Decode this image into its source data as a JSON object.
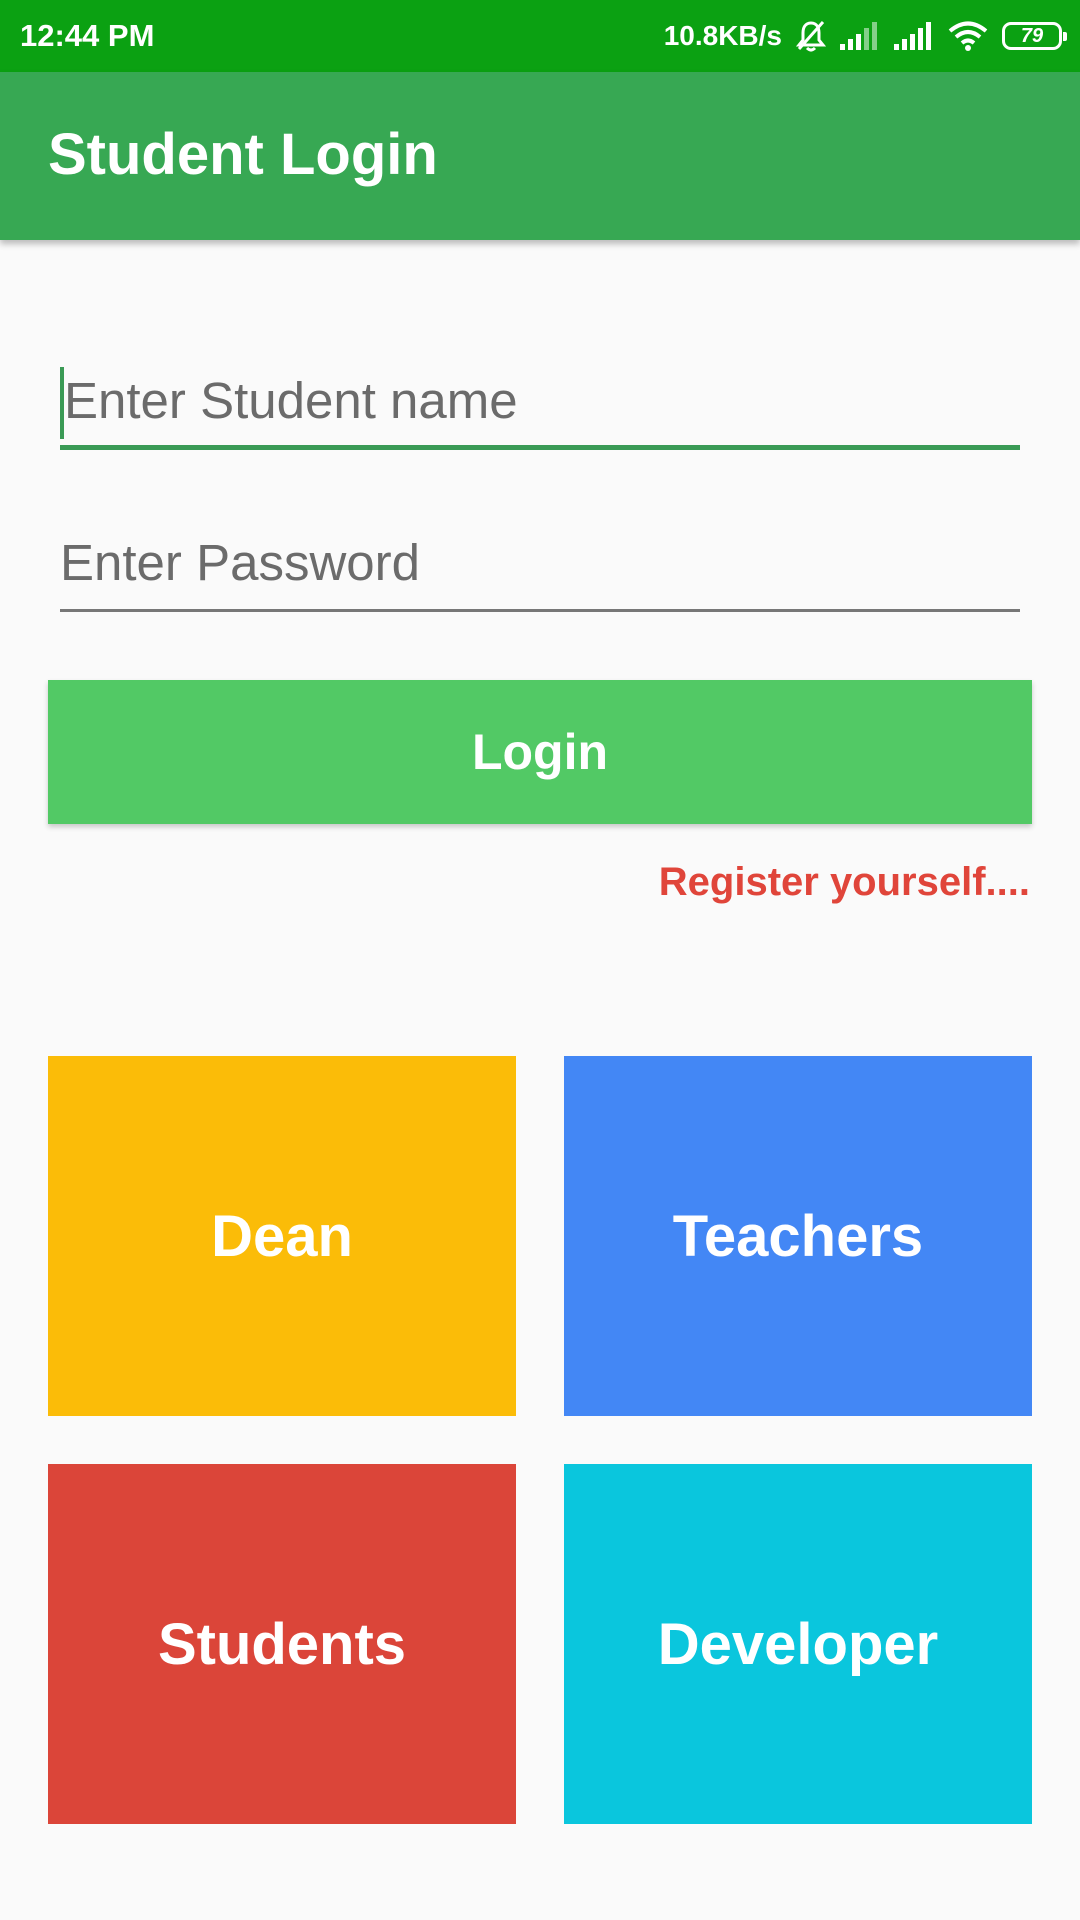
{
  "status_bar": {
    "time": "12:44 PM",
    "network_speed": "10.8KB/s",
    "battery_level": "79",
    "icons": [
      "mute-bell-icon",
      "signal-icon",
      "signal-icon",
      "wifi-icon",
      "battery-icon"
    ]
  },
  "app_bar": {
    "title": "Student Login",
    "color": "#37a853"
  },
  "form": {
    "name_placeholder": "Enter Student name",
    "password_placeholder": "Enter Password",
    "login_label": "Login",
    "register_label": "Register yourself...."
  },
  "tiles": [
    {
      "label": "Dean",
      "color": "#fbbc08"
    },
    {
      "label": "Teachers",
      "color": "#4387f5"
    },
    {
      "label": "Students",
      "color": "#db4539"
    },
    {
      "label": "Developer",
      "color": "#0ac6dd"
    }
  ]
}
